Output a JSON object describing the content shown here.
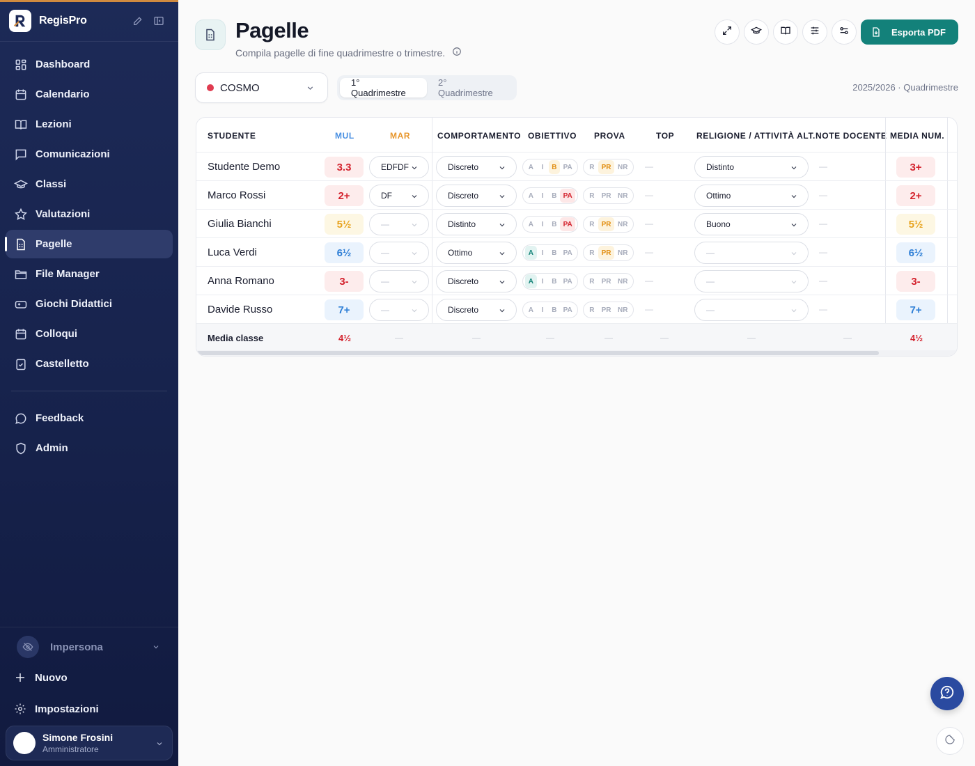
{
  "app": {
    "name": "RegisPro"
  },
  "sidebar": {
    "items": [
      {
        "label": "Dashboard",
        "icon": "dashboard-icon"
      },
      {
        "label": "Calendario",
        "icon": "calendar-icon"
      },
      {
        "label": "Lezioni",
        "icon": "book-icon"
      },
      {
        "label": "Comunicazioni",
        "icon": "message-icon"
      },
      {
        "label": "Classi",
        "icon": "graduation-cap-icon"
      },
      {
        "label": "Valutazioni",
        "icon": "star-icon"
      },
      {
        "label": "Pagelle",
        "icon": "document-icon",
        "active": true
      },
      {
        "label": "File Manager",
        "icon": "folder-icon"
      },
      {
        "label": "Giochi Didattici",
        "icon": "gamepad-icon"
      },
      {
        "label": "Colloqui",
        "icon": "calendar-icon"
      },
      {
        "label": "Castelletto",
        "icon": "clipboard-check-icon"
      }
    ],
    "secondary": [
      {
        "label": "Feedback",
        "icon": "chat-bubble-icon"
      },
      {
        "label": "Admin",
        "icon": "shield-icon"
      }
    ],
    "impersona": "Impersona",
    "new_label": "Nuovo",
    "settings_label": "Impostazioni",
    "user": {
      "name": "Simone Frosini",
      "role": "Amministratore"
    }
  },
  "header": {
    "title": "Pagelle",
    "subtitle": "Compila pagelle di fine quadrimestre o trimestre.",
    "export_label": "Esporta PDF"
  },
  "controls": {
    "class_name": "COSMO",
    "class_color": "#e03b50",
    "tabs": [
      "1° Quadrimestre",
      "2° Quadrimestre"
    ],
    "active_tab": 0,
    "year_label": "2025/2026 · Quadrimestre"
  },
  "table": {
    "headers": {
      "studente": "STUDENTE",
      "mul": "MUL",
      "mar": "MAR",
      "comportamento": "COMPORTAMENTO",
      "obiettivo": "OBIETTIVO",
      "prova": "PROVA",
      "top": "TOP",
      "religione": "RELIGIONE / ATTIVITÀ ALT.",
      "note": "NOTE DOCENTE",
      "media": "MEDIA NUM."
    },
    "obiettivo_options": [
      "A",
      "I",
      "B",
      "PA"
    ],
    "prova_options": [
      "R",
      "PR",
      "NR"
    ],
    "dash": "—",
    "rows": [
      {
        "name": "Studente Demo",
        "mul": "3.3",
        "mul_tone": "red",
        "mar": "EDFDF",
        "comportamento": "Discreto",
        "obiettivo": "B",
        "prova": "PR",
        "top": "—",
        "religione": "Distinto",
        "note": "—",
        "media": "3+",
        "media_tone": "red"
      },
      {
        "name": "Marco Rossi",
        "mul": "2+",
        "mul_tone": "red",
        "mar": "DF",
        "comportamento": "Discreto",
        "obiettivo": "PA",
        "prova": "",
        "top": "—",
        "religione": "Ottimo",
        "note": "—",
        "media": "2+",
        "media_tone": "red"
      },
      {
        "name": "Giulia Bianchi",
        "mul": "5½",
        "mul_tone": "yellow",
        "mar": "—",
        "comportamento": "Distinto",
        "obiettivo": "PA",
        "prova": "PR",
        "top": "—",
        "religione": "Buono",
        "note": "—",
        "media": "5½",
        "media_tone": "yellow"
      },
      {
        "name": "Luca Verdi",
        "mul": "6½",
        "mul_tone": "blue",
        "mar": "—",
        "comportamento": "Ottimo",
        "obiettivo": "A",
        "prova": "PR",
        "top": "—",
        "religione": "—",
        "note": "—",
        "media": "6½",
        "media_tone": "blue"
      },
      {
        "name": "Anna Romano",
        "mul": "3-",
        "mul_tone": "red",
        "mar": "—",
        "comportamento": "Discreto",
        "obiettivo": "A",
        "prova": "",
        "top": "—",
        "religione": "—",
        "note": "—",
        "media": "3-",
        "media_tone": "red"
      },
      {
        "name": "Davide Russo",
        "mul": "7+",
        "mul_tone": "blue",
        "mar": "—",
        "comportamento": "Discreto",
        "obiettivo": "",
        "prova": "",
        "top": "—",
        "religione": "—",
        "note": "—",
        "media": "7+",
        "media_tone": "blue"
      }
    ],
    "footer": {
      "label": "Media classe",
      "mul": "4½",
      "media": "4½"
    }
  }
}
